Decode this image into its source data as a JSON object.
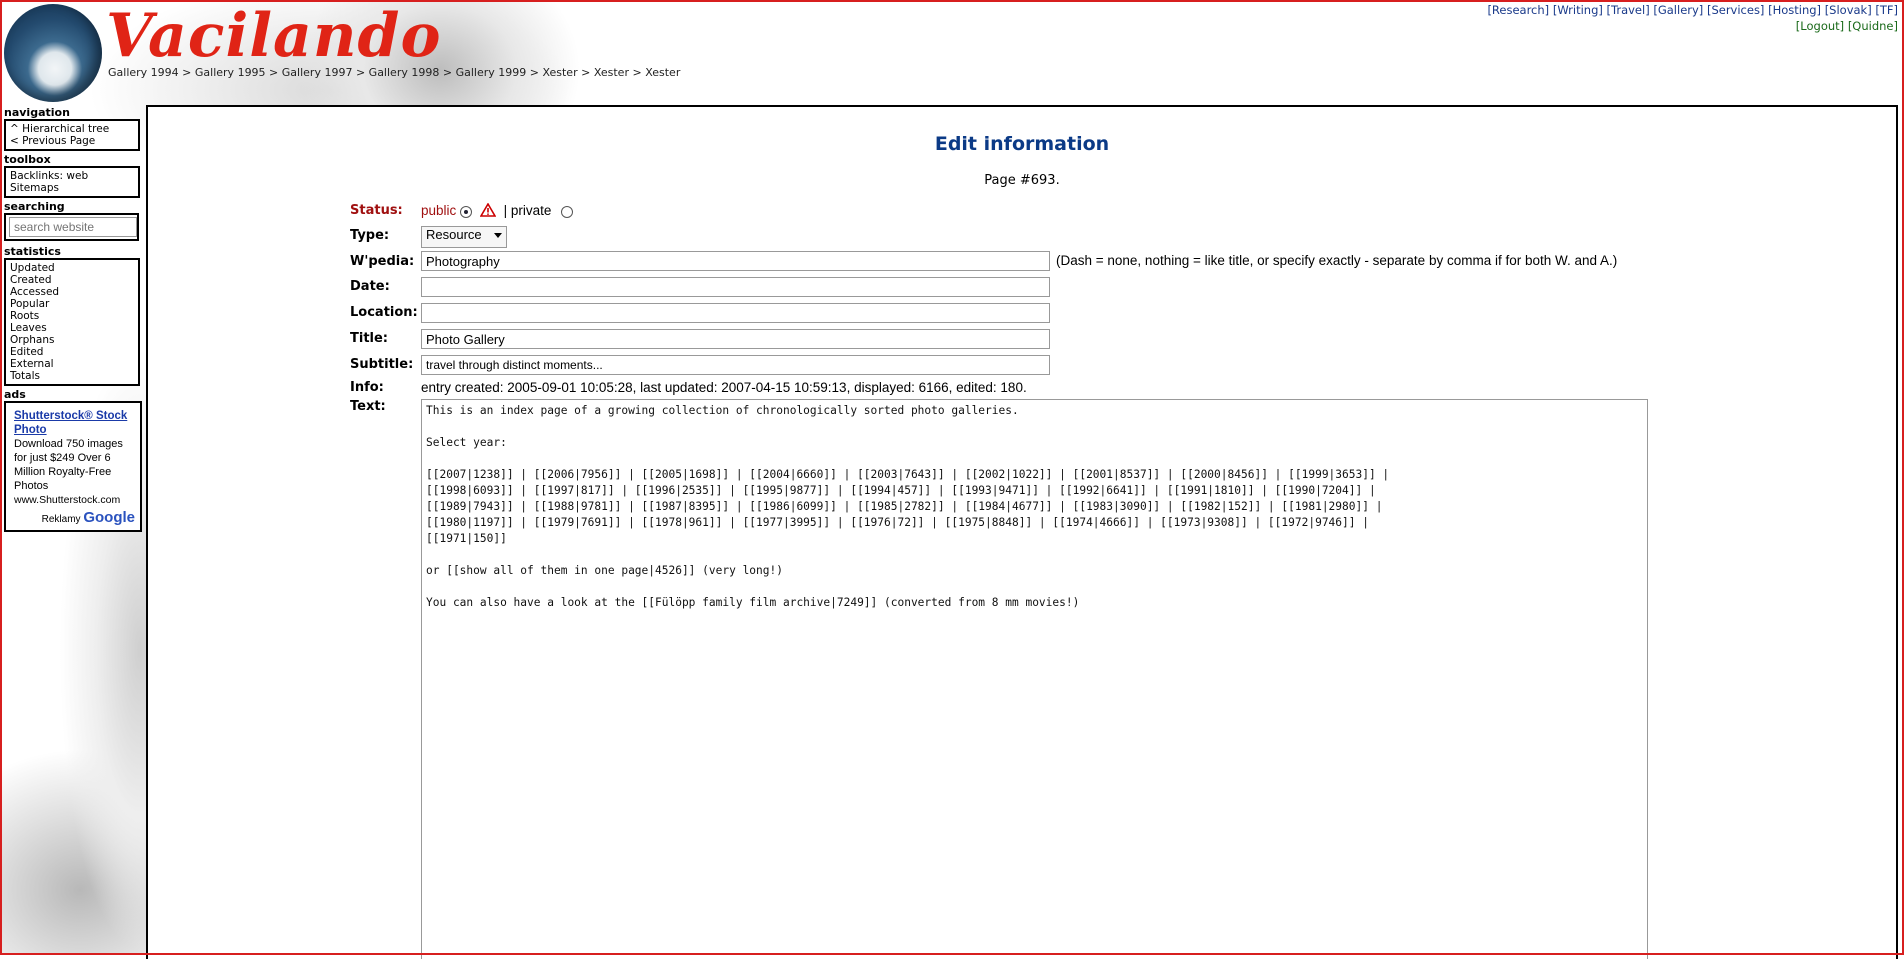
{
  "site": {
    "logo_text": "Vacilando"
  },
  "breadcrumb": [
    "Gallery 1994",
    "Gallery 1995",
    "Gallery 1997",
    "Gallery 1998",
    "Gallery 1999",
    "Xester",
    "Xester",
    "Xester"
  ],
  "topnav": {
    "row1": [
      "[Research]",
      "[Writing]",
      "[Travel]",
      "[Gallery]",
      "[Services]",
      "[Hosting]",
      "[Slovak]",
      "[TF]"
    ],
    "row2": [
      "[Logout]",
      "[Quidne]"
    ]
  },
  "sidebar": {
    "navigation_title": "navigation",
    "navigation_items": [
      "^ Hierarchical tree",
      "< Previous Page"
    ],
    "toolbox_title": "toolbox",
    "toolbox_items": [
      "Backlinks: web",
      "Sitemaps"
    ],
    "searching_title": "searching",
    "search_placeholder": "search website",
    "statistics_title": "statistics",
    "statistics_items": [
      "Updated",
      "Created",
      "Accessed",
      "Popular",
      "Roots",
      "Leaves",
      "Orphans",
      "Edited",
      "External",
      "Totals"
    ],
    "ads_title": "ads",
    "ad": {
      "link": "Shutterstock® Stock Photo",
      "text": "Download 750 images for just $249 Over 6 Million Royalty-Free Photos",
      "url": "www.Shutterstock.com",
      "reklamy": "Reklamy",
      "google": "Google"
    }
  },
  "page": {
    "heading": "Edit information",
    "page_number": "Page #693."
  },
  "form": {
    "status_label": "Status:",
    "status_public": "public",
    "status_sep": "|",
    "status_private": "private",
    "type_label": "Type:",
    "type_value": "Resource",
    "wpedia_label": "W'pedia:",
    "wpedia_value": "Photography",
    "wpedia_hint": "(Dash = none, nothing = like title, or specify exactly - separate by comma if for both W. and A.)",
    "date_label": "Date:",
    "date_value": "",
    "location_label": "Location:",
    "location_value": "",
    "title_label": "Title:",
    "title_value": "Photo Gallery",
    "subtitle_label": "Subtitle:",
    "subtitle_value": "travel through distinct moments...",
    "info_label": "Info:",
    "info_value": "entry created: 2005-09-01 10:05:28, last updated: 2007-04-15 10:59:13, displayed: 6166, edited: 180.",
    "text_label": "Text:",
    "text_value": "This is an index page of a growing collection of chronologically sorted photo galleries.\n\nSelect year:\n\n[[2007|1238]] | [[2006|7956]] | [[2005|1698]] | [[2004|6660]] | [[2003|7643]] | [[2002|1022]] | [[2001|8537]] | [[2000|8456]] | [[1999|3653]] |\n[[1998|6093]] | [[1997|817]] | [[1996|2535]] | [[1995|9877]] | [[1994|457]] | [[1993|9471]] | [[1992|6641]] | [[1991|1810]] | [[1990|7204]] |\n[[1989|7943]] | [[1988|9781]] | [[1987|8395]] | [[1986|6099]] | [[1985|2782]] | [[1984|4677]] | [[1983|3090]] | [[1982|152]] | [[1981|2980]] |\n[[1980|1197]] | [[1979|7691]] | [[1978|961]] | [[1977|3995]] | [[1976|72]] | [[1975|8848]] | [[1974|4666]] | [[1973|9308]] | [[1972|9746]] |\n[[1971|150]]\n\nor [[show all of them in one page|4526]] (very long!)\n\nYou can also have a look at the [[Fülöpp family film archive|7249]] (converted from 8 mm movies!)"
  }
}
